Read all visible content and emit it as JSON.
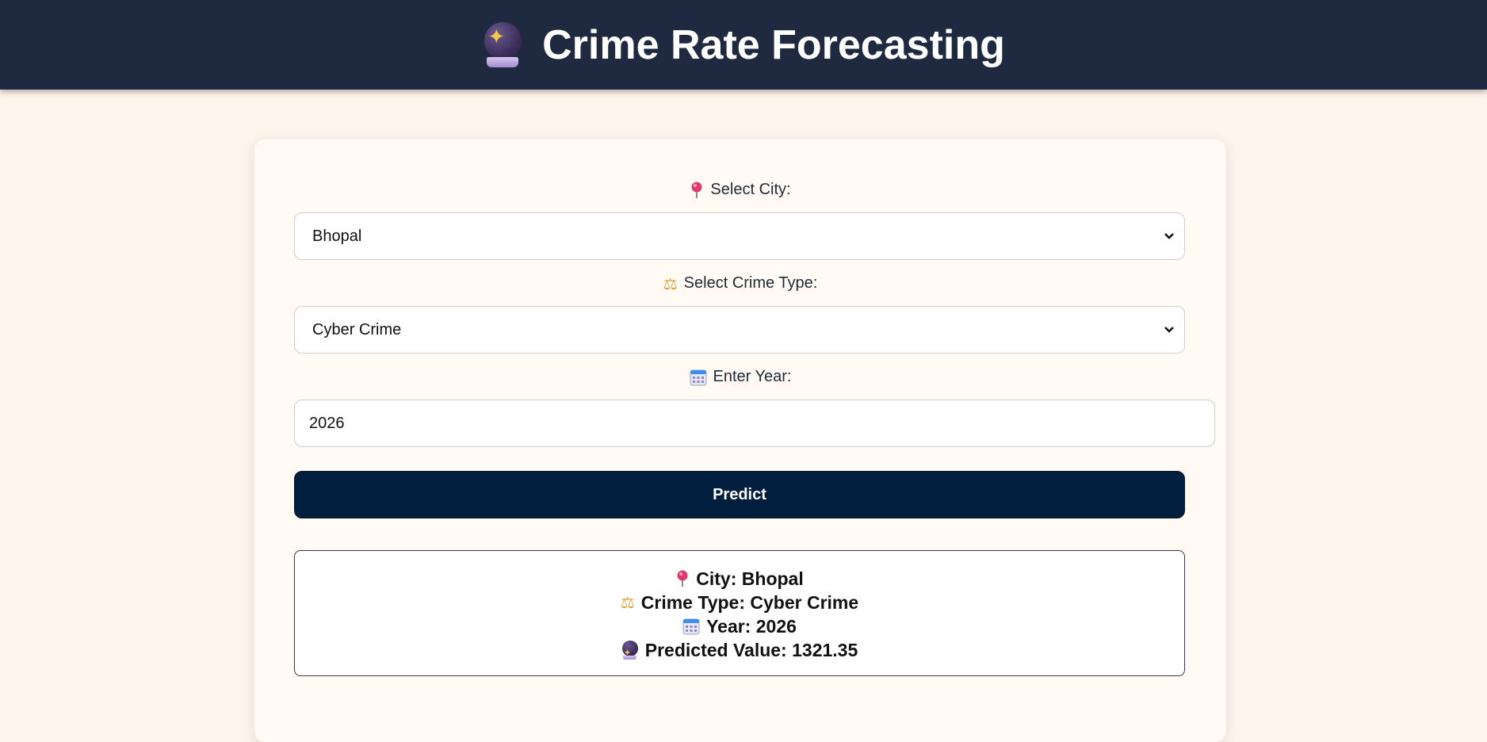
{
  "header": {
    "title": "Crime Rate Forecasting",
    "icon": "crystal-ball-icon"
  },
  "form": {
    "city": {
      "label": "Select City:",
      "icon": "pin-icon",
      "selected": "Bhopal"
    },
    "crime_type": {
      "label": "Select Crime Type:",
      "icon": "scales-icon",
      "selected": "Cyber Crime"
    },
    "year": {
      "label": "Enter Year:",
      "icon": "calendar-icon",
      "value": "2026"
    },
    "predict_label": "Predict"
  },
  "result": {
    "city_label": "City:",
    "city_value": "Bhopal",
    "crime_type_label": "Crime Type:",
    "crime_type_value": "Cyber Crime",
    "year_label": "Year:",
    "year_value": "2026",
    "predicted_label": "Predicted Value:",
    "predicted_value": "1321.35"
  },
  "colors": {
    "header_bg": "#1f2a40",
    "page_bg": "#fdf5ec",
    "button_bg": "#011e3e",
    "pin": "#e03a6a"
  }
}
